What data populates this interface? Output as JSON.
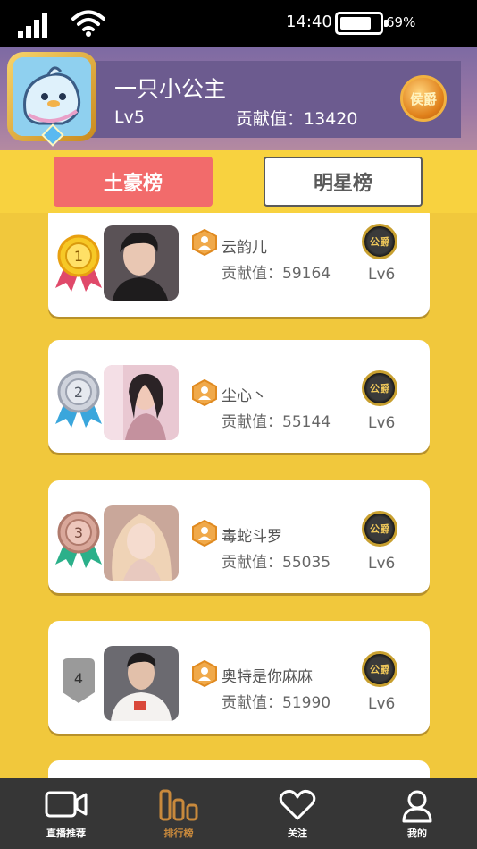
{
  "status_bar": {
    "time": "14:40",
    "battery": "69%"
  },
  "profile": {
    "nickname": "一只小公主",
    "level": "Lv5",
    "contribution_label": "贡献值：",
    "contribution_value": "13420",
    "rank_badge": "侯爵"
  },
  "tabs": [
    {
      "label": "土豪榜",
      "active": true
    },
    {
      "label": "明星榜",
      "active": false
    }
  ],
  "ranking": [
    {
      "rank": "1",
      "name": "云韵儿",
      "contribution": "贡献值：59164",
      "title_badge": "公爵",
      "level": "Lv6",
      "medal_color": "#e8b21c",
      "ribbon_color": "#e0496a"
    },
    {
      "rank": "2",
      "name": "尘心丶",
      "contribution": "贡献值：55144",
      "title_badge": "公爵",
      "level": "Lv6",
      "medal_color": "#b8bcc8",
      "ribbon_color": "#3aa6dc"
    },
    {
      "rank": "3",
      "name": "毒蛇斗罗",
      "contribution": "贡献值：55035",
      "title_badge": "公爵",
      "level": "Lv6",
      "medal_color": "#c89a8a",
      "ribbon_color": "#2bb08a"
    },
    {
      "rank": "4",
      "name": "奥特是你麻麻",
      "contribution": "贡献值：51990",
      "title_badge": "公爵",
      "level": "Lv6",
      "medal_color": "#9a9a9a",
      "ribbon_color": "#9a9a9a"
    }
  ],
  "bottom_nav": [
    {
      "label": "直播推荐",
      "icon": "camera-icon",
      "active": false
    },
    {
      "label": "排行榜",
      "icon": "ranking-icon",
      "active": true
    },
    {
      "label": "关注",
      "icon": "heart-icon",
      "active": false
    },
    {
      "label": "我的",
      "icon": "user-icon",
      "active": false
    }
  ]
}
